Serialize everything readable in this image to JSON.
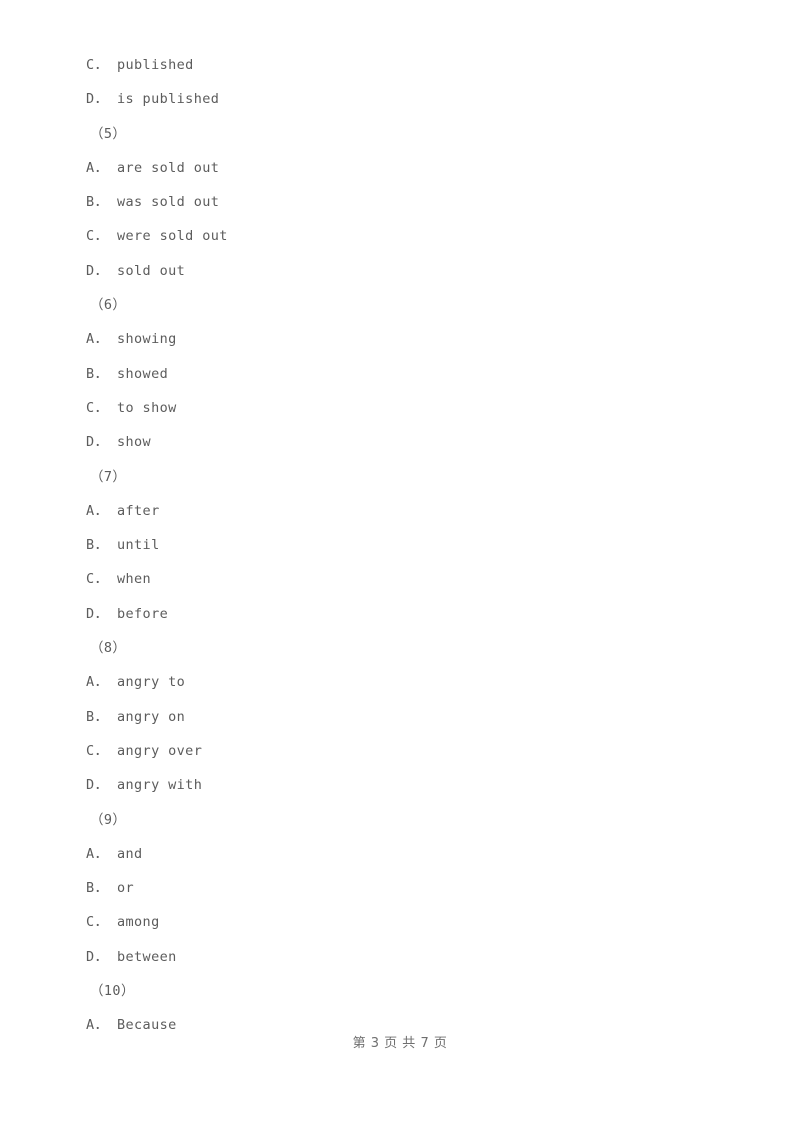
{
  "document": {
    "page_background": "#ffffff",
    "text_color": "#5c5c5c",
    "footer_color": "#6f6f6f",
    "lines": [
      {
        "kind": "option",
        "text": "C． published"
      },
      {
        "kind": "option",
        "text": "D． is published"
      },
      {
        "kind": "qnum",
        "text": "（5）"
      },
      {
        "kind": "option",
        "text": "A． are sold out"
      },
      {
        "kind": "option",
        "text": "B． was sold out"
      },
      {
        "kind": "option",
        "text": "C． were sold out"
      },
      {
        "kind": "option",
        "text": "D． sold out"
      },
      {
        "kind": "qnum",
        "text": "（6）"
      },
      {
        "kind": "option",
        "text": "A． showing"
      },
      {
        "kind": "option",
        "text": "B． showed"
      },
      {
        "kind": "option",
        "text": "C． to show"
      },
      {
        "kind": "option",
        "text": "D． show"
      },
      {
        "kind": "qnum",
        "text": "（7）"
      },
      {
        "kind": "option",
        "text": "A． after"
      },
      {
        "kind": "option",
        "text": "B． until"
      },
      {
        "kind": "option",
        "text": "C． when"
      },
      {
        "kind": "option",
        "text": "D． before"
      },
      {
        "kind": "qnum",
        "text": "（8）"
      },
      {
        "kind": "option",
        "text": "A． angry to"
      },
      {
        "kind": "option",
        "text": "B． angry on"
      },
      {
        "kind": "option",
        "text": "C． angry over"
      },
      {
        "kind": "option",
        "text": "D． angry with"
      },
      {
        "kind": "qnum",
        "text": "（9）"
      },
      {
        "kind": "option",
        "text": "A． and"
      },
      {
        "kind": "option",
        "text": "B． or"
      },
      {
        "kind": "option",
        "text": "C． among"
      },
      {
        "kind": "option",
        "text": "D． between"
      },
      {
        "kind": "qnum",
        "text": "（10）"
      },
      {
        "kind": "option",
        "text": "A． Because"
      }
    ]
  },
  "footer": {
    "text": "第 3 页 共 7 页",
    "current_page": "3",
    "total_pages": "7"
  }
}
